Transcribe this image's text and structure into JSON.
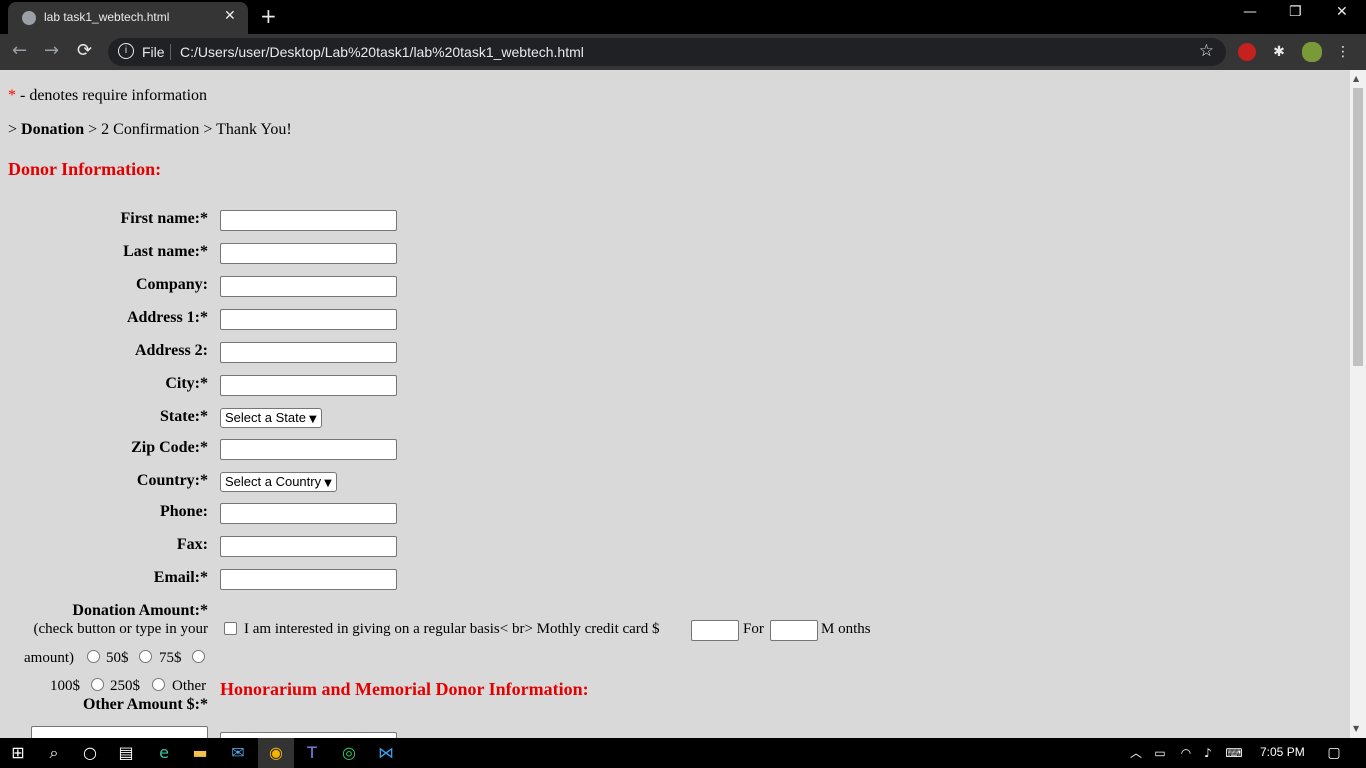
{
  "browser": {
    "tab_title": "lab task1_webtech.html",
    "tab_close": "✕",
    "new_tab": "+",
    "win_min": "—",
    "win_restore": "❐",
    "win_close": "✕",
    "back": "←",
    "forward": "→",
    "reload": "⟳",
    "info_glyph": "i",
    "file_label": "File",
    "url": "C:/Users/user/Desktop/Lab%20task1/lab%20task1_webtech.html",
    "star": "☆",
    "menu": "⋮"
  },
  "page": {
    "req_star": "*",
    "req_text": " - denotes require information",
    "crumb_prefix": "> ",
    "crumb_current": "Donation",
    "crumb_rest": " > 2 Confirmation > Thank You!",
    "donor_heading": "Donor Information:",
    "fields": {
      "first_name": "First name:*",
      "last_name": "Last name:*",
      "company": "Company:",
      "address1": "Address 1:*",
      "address2": "Address 2:",
      "city": "City:*",
      "state": "State:*",
      "zip": "Zip Code:*",
      "country": "Country:*",
      "phone": "Phone:",
      "fax": "Fax:",
      "email": "Email:*"
    },
    "state_select": "Select a State",
    "country_select": "Select a Country",
    "donation_label": "Donation Amount:*",
    "donation_hint_1": "(check button or type in your",
    "donation_hint_2": "amount)",
    "opt_50": "50$",
    "opt_75": "75$",
    "opt_100": "100$",
    "opt_250": "250$",
    "opt_other": "Other",
    "other_amount": "Other Amount $:*",
    "regular_text": "I am interested in giving on a regular basis< br> Mothly credit card $",
    "for_text": "For",
    "months_text": "M onths",
    "honor_heading": "Honorarium and Memorial Donor Information:"
  },
  "taskbar": {
    "time": "7:05 PM"
  }
}
